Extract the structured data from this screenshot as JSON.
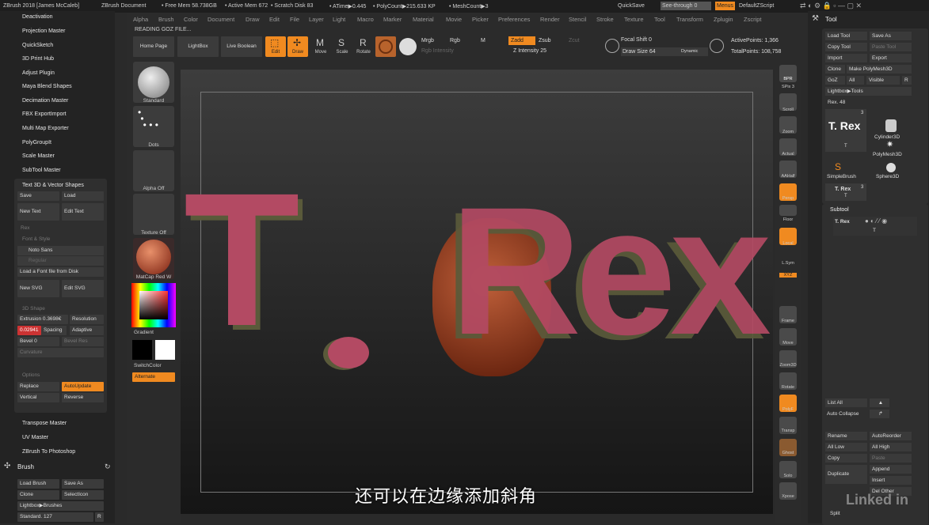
{
  "title": {
    "app": "ZBrush 2018 [James McCaleb]",
    "doc": "ZBrush Document",
    "freemem": "• Free Mem 58.738GB",
    "activemem": "• Active Mem 672",
    "scratch": "• Scratch Disk 83",
    "atime": "• ATime▶0.445",
    "polycount": "• PolyCount▶215.633 KP",
    "meshcount": "• MeshCount▶3",
    "quicksave": "QuickSave",
    "seethrough": "See-through  0",
    "menus": "Menus",
    "script": "DefaultZScript"
  },
  "menu": [
    "Alpha",
    "Brush",
    "Color",
    "Document",
    "Draw",
    "Edit",
    "File",
    "Layer",
    "Light",
    "Macro",
    "Marker",
    "Material",
    "Movie",
    "Picker",
    "Preferences",
    "Render",
    "Stencil",
    "Stroke",
    "Texture",
    "Tool",
    "Transform",
    "Zplugin",
    "Zscript"
  ],
  "status": "READING GOZ FILE...",
  "plugins_top": [
    "Deactivation",
    "Projection Master",
    "QuickSketch",
    "3D Print Hub",
    "Adjust Plugin",
    "Maya Blend Shapes",
    "Decimation Master",
    "FBX ExportImport",
    "Multi Map Exporter",
    "PolyGroupIt",
    "Scale Master",
    "SubTool Master"
  ],
  "text3d": {
    "header": "Text 3D & Vector Shapes",
    "save": "Save",
    "load": "Load",
    "newtext": "New Text",
    "edittext": "Edit Text",
    "rex": "Rex",
    "fontstyle": "Font & Style",
    "font": "Noto Sans",
    "regular": "Regular",
    "loadfont": "Load a Font file from Disk",
    "newsvg": "New SVG",
    "editsvg": "Edit SVG",
    "shape3d": "3D Shape",
    "extrusion": "Extrusion 0.3698€",
    "resolution": "Resolution",
    "spacingval": "0.02941",
    "spacing": "Spacing",
    "adaptive": "Adaptive",
    "bevel": "Bevel 0",
    "bevelres": "Bevel Res",
    "curvature": "Curvature",
    "options": "Options",
    "replace": "Replace",
    "autoupdate": "AutoUpdate",
    "vertical": "Vertical",
    "reverse": "Reverse"
  },
  "plugins_bottom": [
    "Transpose Master",
    "UV Master",
    "ZBrush To Photoshop"
  ],
  "brush": {
    "header": "Brush",
    "loadbrush": "Load Brush",
    "saveas": "Save As",
    "clone": "Clone",
    "selecticon": "SelectIcon",
    "lightbox": "Lightbox▶Brushes",
    "standard": "Standard. 127",
    "r": "R"
  },
  "toolbar": {
    "home": "Home Page",
    "lightbox": "LightBox",
    "liveboolean": "Live Boolean",
    "edit": "Edit",
    "draw": "Draw",
    "move": "Move",
    "scale": "Scale",
    "rotate": "Rotate",
    "mrgb": "Mrgb",
    "rgb": "Rgb",
    "m": "M",
    "zadd": "Zadd",
    "zsub": "Zsub",
    "zcut": "Zcut",
    "rgbint": "Rgb Intensity",
    "zint": "Z Intensity 25",
    "focal": "Focal Shift 0",
    "drawsize": "Draw Size 64",
    "dynamic": "Dynamic",
    "activepoints": "ActivePoints: 1,366",
    "totalpoints": "TotalPoints: 108,758"
  },
  "shelf": {
    "standard": "Standard",
    "dots": "Dots",
    "alphaoff": "Alpha Off",
    "textureoff": "Texture Off",
    "matcap": "MatCap Red W",
    "gradient": "Gradient",
    "switchcolor": "SwitchColor",
    "alternate": "Alternate"
  },
  "canvas": {
    "t": "T",
    "dot": ".",
    "rex": "Rex"
  },
  "rightshelf": [
    "BPR",
    "SPix 3",
    "Scroll",
    "Zoom",
    "Actual",
    "AAHalf",
    "Persp",
    "Floor",
    "Local",
    "L.Sym",
    "XYZ",
    "Frame",
    "Move",
    "Zoom3D",
    "Rotate",
    "PolyF",
    "Transp",
    "Ghost",
    "Solo",
    "Xpose"
  ],
  "tool": {
    "header": "Tool",
    "loadtool": "Load Tool",
    "saveas": "Save As",
    "copytool": "Copy Tool",
    "pastetool": "Paste Tool",
    "import": "Import",
    "export": "Export",
    "clone": "Clone",
    "makepoly": "Make PolyMesh3D",
    "goz": "GoZ",
    "all": "All",
    "visible": "Visible",
    "r": "R",
    "lightboxtools": "Lightbox▶Tools",
    "rex48": "Rex. 48",
    "trex": "T. Rex",
    "num3": "3",
    "t": "T",
    "cylinder": "Cylinder3D",
    "polymesh": "PolyMesh3D",
    "simplebrush": "SimpleBrush",
    "sphere": "Sphere3D",
    "trexsmall": "T. Rex",
    "subtool": "Subtool",
    "subitem": "T. Rex",
    "subt": "T",
    "listall": "List All",
    "autocollapse": "Auto Collapse",
    "rename": "Rename",
    "autoreorder": "AutoReorder",
    "alllow": "All Low",
    "allhigh": "All High",
    "copy": "Copy",
    "paste": "Paste",
    "duplicate": "Duplicate",
    "append": "Append",
    "insert": "Insert",
    "delother": "Del Other",
    "split": "Split"
  },
  "subtitle": "还可以在边缘添加斜角",
  "watermark": "Linked in"
}
